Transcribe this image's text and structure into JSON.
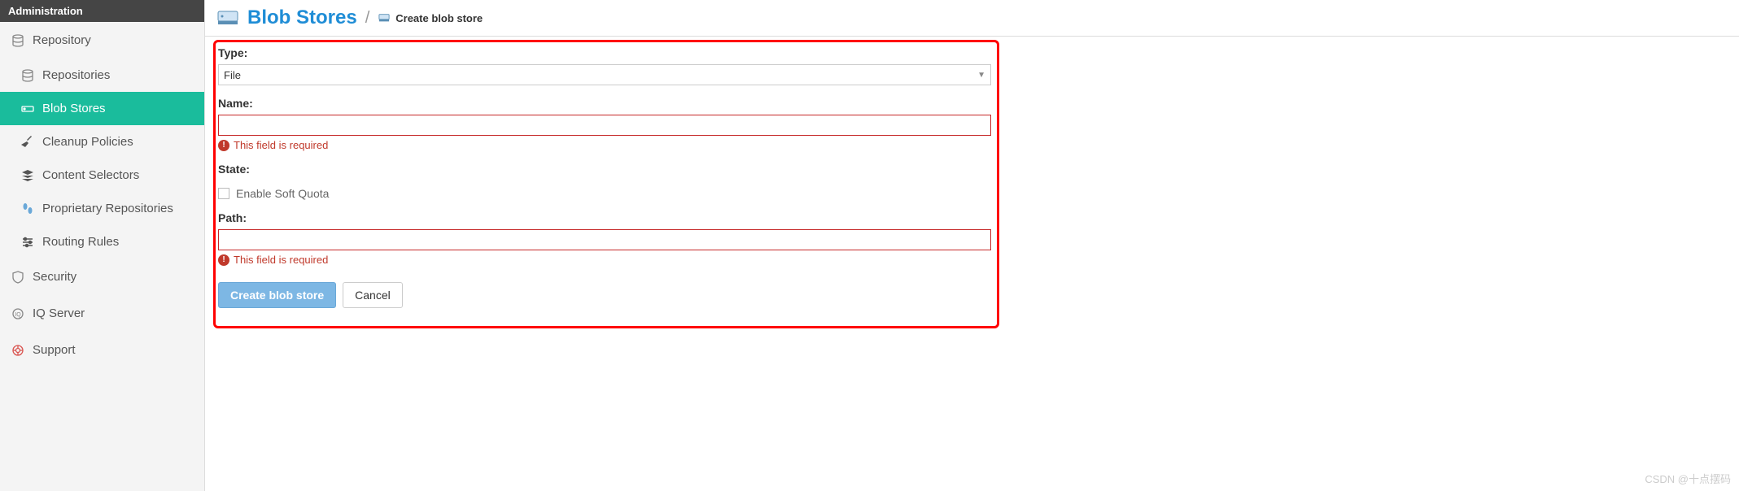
{
  "sidebar": {
    "header": "Administration",
    "groups": [
      {
        "label": "Repository",
        "items": [
          {
            "label": "Repositories",
            "icon": "db"
          },
          {
            "label": "Blob Stores",
            "icon": "hdd",
            "active": true
          },
          {
            "label": "Cleanup Policies",
            "icon": "broom"
          },
          {
            "label": "Content Selectors",
            "icon": "layers"
          },
          {
            "label": "Proprietary Repositories",
            "icon": "steps"
          },
          {
            "label": "Routing Rules",
            "icon": "sliders"
          }
        ]
      },
      {
        "label": "Security",
        "items": []
      },
      {
        "label": "IQ Server",
        "items": []
      },
      {
        "label": "Support",
        "items": []
      }
    ]
  },
  "breadcrumb": {
    "title": "Blob Stores",
    "separator": "/",
    "sub_label": "Create blob store"
  },
  "form": {
    "type_label": "Type:",
    "type_value": "File",
    "name_label": "Name:",
    "name_value": "",
    "name_error": "This field is required",
    "state_label": "State:",
    "quota_label": "Enable Soft Quota",
    "quota_checked": false,
    "path_label": "Path:",
    "path_value": "",
    "path_error": "This field is required",
    "submit_label": "Create blob store",
    "cancel_label": "Cancel"
  },
  "watermark": "CSDN @十点摆码"
}
